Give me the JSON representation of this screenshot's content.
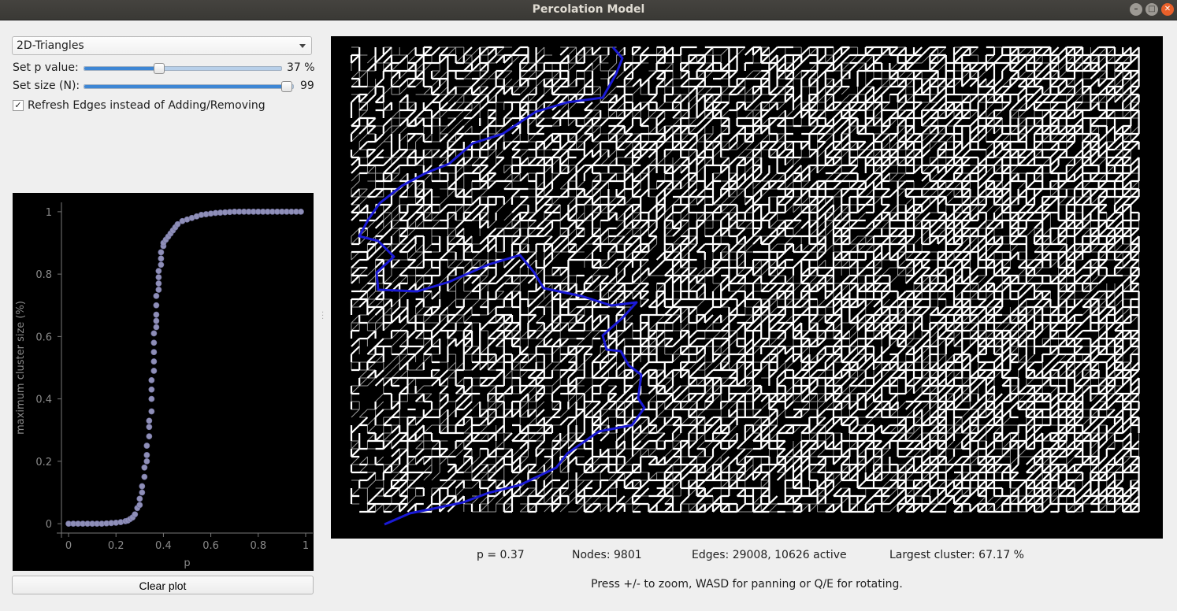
{
  "window": {
    "title": "Percolation Model"
  },
  "controls": {
    "mode": "2D-Triangles",
    "p_label": "Set p value:",
    "p_value": 37,
    "p_value_text": "37 %",
    "size_label": "Set size (N):",
    "size_value": 99,
    "size_value_text": "99",
    "size_max": 100,
    "refresh_checked": true,
    "refresh_label": "Refresh Edges instead of Adding/Removing"
  },
  "plot": {
    "clear_label": "Clear plot"
  },
  "chart_data": {
    "type": "scatter",
    "xlabel": "p",
    "ylabel": "maximum cluster size (%)",
    "xlim": [
      -0.03,
      1.03
    ],
    "ylim": [
      -0.03,
      1.03
    ],
    "xticks": [
      "0",
      "0.2",
      "0.4",
      "0.6",
      "0.8",
      "1"
    ],
    "yticks": [
      "0",
      "0.2",
      "0.4",
      "0.6",
      "0.8",
      "1"
    ],
    "marker_color": "#8f8fb8",
    "series": [
      {
        "points": [
          [
            0.0,
            0.0
          ],
          [
            0.02,
            0.0
          ],
          [
            0.04,
            0.0
          ],
          [
            0.06,
            0.0
          ],
          [
            0.08,
            0.0
          ],
          [
            0.1,
            0.0
          ],
          [
            0.12,
            0.0
          ],
          [
            0.14,
            0.0
          ],
          [
            0.16,
            0.001
          ],
          [
            0.18,
            0.002
          ],
          [
            0.2,
            0.003
          ],
          [
            0.22,
            0.005
          ],
          [
            0.24,
            0.008
          ],
          [
            0.25,
            0.01
          ],
          [
            0.26,
            0.015
          ],
          [
            0.27,
            0.02
          ],
          [
            0.28,
            0.03
          ],
          [
            0.29,
            0.05
          ],
          [
            0.3,
            0.06
          ],
          [
            0.3,
            0.08
          ],
          [
            0.31,
            0.1
          ],
          [
            0.31,
            0.12
          ],
          [
            0.32,
            0.15
          ],
          [
            0.32,
            0.18
          ],
          [
            0.33,
            0.2
          ],
          [
            0.33,
            0.22
          ],
          [
            0.33,
            0.25
          ],
          [
            0.34,
            0.28
          ],
          [
            0.34,
            0.31
          ],
          [
            0.34,
            0.33
          ],
          [
            0.35,
            0.36
          ],
          [
            0.35,
            0.4
          ],
          [
            0.35,
            0.43
          ],
          [
            0.35,
            0.46
          ],
          [
            0.36,
            0.49
          ],
          [
            0.36,
            0.52
          ],
          [
            0.36,
            0.55
          ],
          [
            0.36,
            0.58
          ],
          [
            0.36,
            0.61
          ],
          [
            0.37,
            0.63
          ],
          [
            0.37,
            0.65
          ],
          [
            0.37,
            0.67
          ],
          [
            0.37,
            0.7
          ],
          [
            0.37,
            0.73
          ],
          [
            0.38,
            0.75
          ],
          [
            0.38,
            0.77
          ],
          [
            0.38,
            0.79
          ],
          [
            0.38,
            0.81
          ],
          [
            0.39,
            0.83
          ],
          [
            0.39,
            0.85
          ],
          [
            0.39,
            0.87
          ],
          [
            0.4,
            0.89
          ],
          [
            0.4,
            0.9
          ],
          [
            0.41,
            0.91
          ],
          [
            0.42,
            0.92
          ],
          [
            0.43,
            0.93
          ],
          [
            0.44,
            0.94
          ],
          [
            0.45,
            0.95
          ],
          [
            0.46,
            0.96
          ],
          [
            0.48,
            0.97
          ],
          [
            0.5,
            0.975
          ],
          [
            0.52,
            0.98
          ],
          [
            0.54,
            0.985
          ],
          [
            0.56,
            0.99
          ],
          [
            0.58,
            0.992
          ],
          [
            0.6,
            0.994
          ],
          [
            0.62,
            0.996
          ],
          [
            0.64,
            0.997
          ],
          [
            0.66,
            0.998
          ],
          [
            0.68,
            0.999
          ],
          [
            0.7,
            1.0
          ],
          [
            0.72,
            1.0
          ],
          [
            0.74,
            1.0
          ],
          [
            0.76,
            1.0
          ],
          [
            0.78,
            1.0
          ],
          [
            0.8,
            1.0
          ],
          [
            0.82,
            1.0
          ],
          [
            0.84,
            1.0
          ],
          [
            0.86,
            1.0
          ],
          [
            0.88,
            1.0
          ],
          [
            0.9,
            1.0
          ],
          [
            0.92,
            1.0
          ],
          [
            0.94,
            1.0
          ],
          [
            0.96,
            1.0
          ],
          [
            0.98,
            1.0
          ]
        ]
      }
    ]
  },
  "status": {
    "p_text": "p = 0.37",
    "nodes_text": "Nodes: 9801",
    "edges_text": "Edges: 29008, 10626 active",
    "cluster_text": "Largest cluster: 67.17 %"
  },
  "hint": "Press +/- to zoom, WASD for panning or Q/E for rotating.",
  "colors": {
    "edge": "#ffffff",
    "largest_cluster_path": "#1a1ad6",
    "graph_background": "#000000"
  }
}
